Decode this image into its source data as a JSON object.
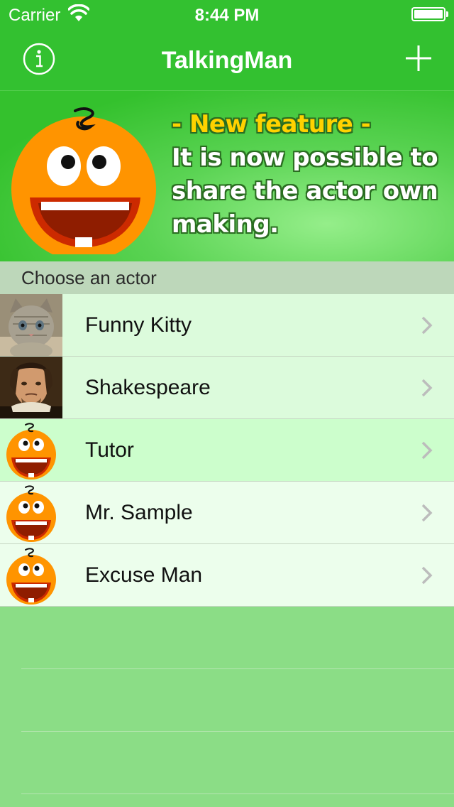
{
  "status_bar": {
    "carrier": "Carrier",
    "time": "8:44 PM"
  },
  "nav": {
    "title": "TalkingMan",
    "info_icon": "info-circle-icon",
    "add_icon": "plus-icon"
  },
  "banner": {
    "headline": "- New feature -",
    "line1": "It is now possible to",
    "line2": "share the actor own",
    "line3": "making."
  },
  "section": {
    "header": "Choose an actor"
  },
  "actors": [
    {
      "name": "Funny Kitty",
      "thumb": "kitten-photo",
      "bg": "#dcfbdc"
    },
    {
      "name": "Shakespeare",
      "thumb": "shakespeare-portrait",
      "bg": "#dcfbdc"
    },
    {
      "name": "Tutor",
      "thumb": "orange-face-icon",
      "bg": "#ccfecc"
    },
    {
      "name": "Mr. Sample",
      "thumb": "orange-face-icon",
      "bg": "#ecfeec"
    },
    {
      "name": "Excuse Man",
      "thumb": "orange-face-icon",
      "bg": "#ecfeec"
    }
  ],
  "colors": {
    "nav_green": "#33c130",
    "headline_yellow": "#ffd200",
    "list_background": "#8bdd86"
  }
}
